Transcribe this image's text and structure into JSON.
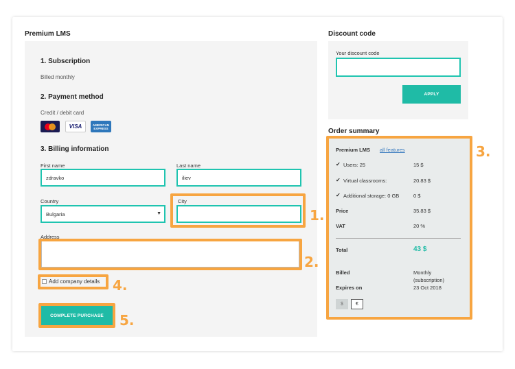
{
  "left": {
    "title": "Premium LMS",
    "subscription": {
      "heading": "1. Subscription",
      "text": "Billed monthly"
    },
    "payment": {
      "heading": "2. Payment method",
      "text": "Credit / debit card",
      "cards": [
        "mastercard-icon",
        "visa-icon",
        "amex-icon"
      ]
    },
    "billing": {
      "heading": "3. Billing information",
      "first_name_label": "First name",
      "first_name_value": "zdravko",
      "last_name_label": "Last name",
      "last_name_value": "iliev",
      "country_label": "Country",
      "country_value": "Bulgaria",
      "city_label": "City",
      "city_value": "",
      "address_label": "Address",
      "address_value": "",
      "company_label": "Add company details"
    },
    "complete_button": "COMPLETE PURCHASE"
  },
  "discount": {
    "title": "Discount code",
    "field_label": "Your discount code",
    "field_value": "",
    "apply_button": "APPLY"
  },
  "summary": {
    "title": "Order summary",
    "plan": "Premium LMS",
    "features_link": "all features",
    "items": [
      {
        "label": "Users: 25",
        "value": "15 $"
      },
      {
        "label": "Virtual classrooms:",
        "value": "20.83 $"
      },
      {
        "label": "Additional storage: 0 GB",
        "value": "0 $"
      }
    ],
    "price_label": "Price",
    "price_value": "35.83 $",
    "vat_label": "VAT",
    "vat_value": "20 %",
    "total_label": "Total",
    "total_value": "43 $",
    "billed_label": "Billed",
    "billed_value_1": "Monthly",
    "billed_value_2": "(subscription)",
    "expires_label": "Expires on",
    "expires_value": "23 Oct 2018",
    "currencies": [
      "$",
      "€"
    ]
  },
  "callouts": [
    "1.",
    "2.",
    "3.",
    "4.",
    "5."
  ],
  "colors": {
    "accent": "#1fbba6",
    "callout": "#f7a541",
    "total": "#1fbba6"
  }
}
